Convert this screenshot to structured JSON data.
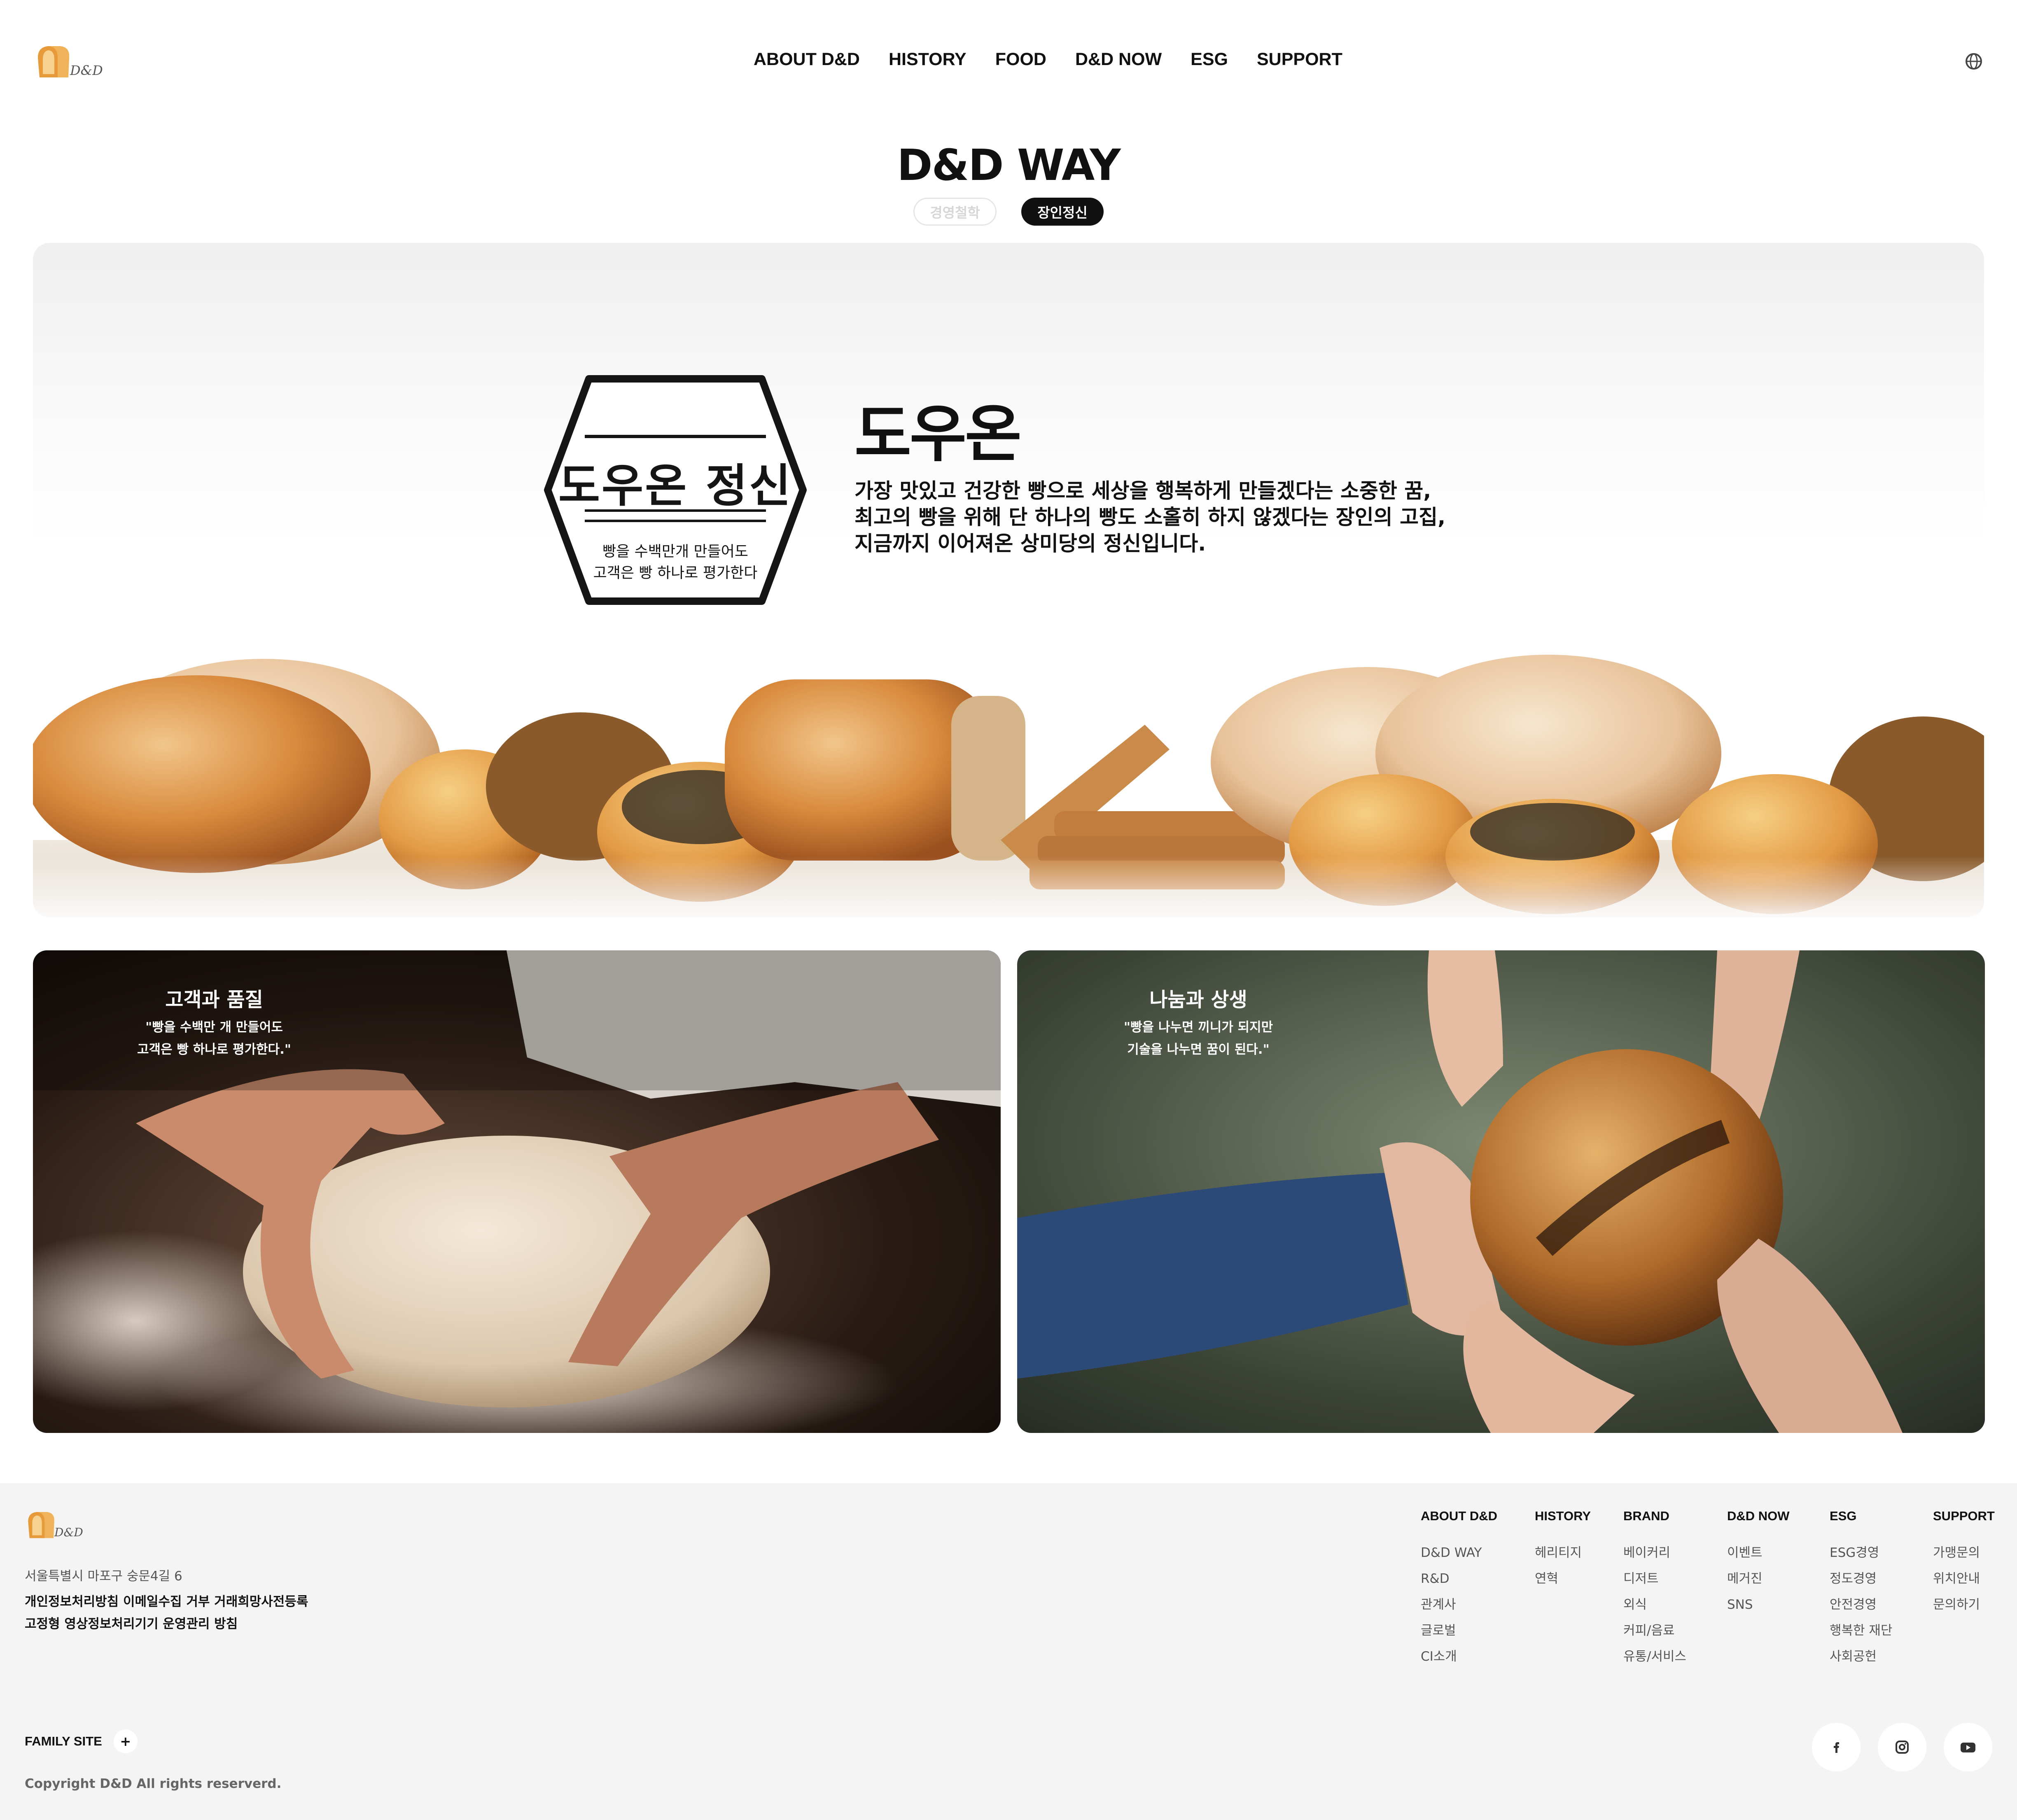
{
  "header": {
    "logo_text": "D&D",
    "nav": [
      "ABOUT D&D",
      "HISTORY",
      "FOOD",
      "D&D NOW",
      "ESG",
      "SUPPORT"
    ]
  },
  "page": {
    "title": "D&D WAY",
    "tabs": [
      {
        "label": "경영철학",
        "active": false
      },
      {
        "label": "장인정신",
        "active": true
      }
    ]
  },
  "hero": {
    "stamp_title": "도우온 정신",
    "stamp_line1": "빵을 수백만개 만들어도",
    "stamp_line2": "고객은 빵 하나로 평가한다",
    "heading": "도우온",
    "lines": [
      "가장 맛있고 건강한 빵으로 세상을 행복하게 만들겠다는 소중한 꿈,",
      "최고의 빵을 위해 단 하나의 빵도 소홀히 하지 않겠다는 장인의 고집,",
      "지금까지 이어져온 상미당의 정신입니다."
    ]
  },
  "cards": [
    {
      "title": "고객과 품질",
      "quote1": "\"빵을 수백만 개 만들어도",
      "quote2": "고객은 빵 하나로 평가한다.\""
    },
    {
      "title": "나눔과 상생",
      "quote1": "\"빵을 나누면 끼니가 되지만",
      "quote2": "기술을 나누면 꿈이 된다.\""
    }
  ],
  "footer": {
    "logo_text": "D&D",
    "address": "서울특별시 마포구 숭문4길 6",
    "policy_line1": "개인정보처리방침 이메일수집 거부 거래희망사전등록",
    "policy_line2": "고정형 영상정보처리기기 운영관리 방침",
    "family_site": "FAMILY SITE",
    "family_plus": "+",
    "copyright": "Copyright D&D All rights reserverd.",
    "columns": [
      {
        "title": "ABOUT D&D",
        "items": [
          "D&D WAY",
          "R&D",
          "관계사",
          "글로벌",
          "CI소개"
        ]
      },
      {
        "title": "HISTORY",
        "items": [
          "헤리티지",
          "연혁"
        ]
      },
      {
        "title": "BRAND",
        "items": [
          "베이커리",
          "디저트",
          "외식",
          "커피/음료",
          "유통/서비스"
        ]
      },
      {
        "title": "D&D NOW",
        "items": [
          "이벤트",
          "메거진",
          "SNS"
        ]
      },
      {
        "title": "ESG",
        "items": [
          "ESG경영",
          "정도경영",
          "안전경영",
          "행복한 재단",
          "사회공헌"
        ]
      },
      {
        "title": "SUPPORT",
        "items": [
          "가맹문의",
          "위치안내",
          "문의하기"
        ]
      }
    ],
    "social": [
      "facebook-icon",
      "instagram-icon",
      "youtube-icon"
    ]
  }
}
